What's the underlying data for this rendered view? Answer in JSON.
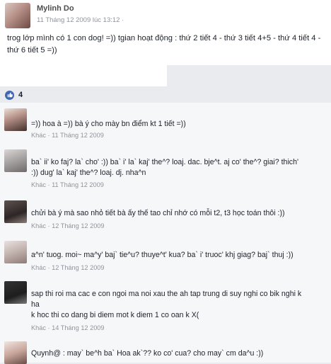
{
  "post": {
    "author": "Mylinh Do",
    "time": "11 Tháng 12 2009 lúc 13:12 ·",
    "text": "trog lớp mình có 1 con dog! =)) tgian hoạt động : thứ 2 tiết 4 - thứ 3 tiết 4+5 - thứ 4 tiết 4 - thứ 6 tiết 5 =))",
    "avatar_icon": "profile-photo-icon"
  },
  "likes": {
    "count": "4",
    "icon": "like-thumb-icon",
    "color": "#4267b2"
  },
  "comments": [
    {
      "lines": [
        "=)) hoa à =)) bà ý cho mày bn điểm kt 1 tiết =))"
      ],
      "meta": "Khác · 11 Tháng 12 2009"
    },
    {
      "lines": [
        "ba` ii' ko faj? la` cho' :)) ba` i' la` kaj' the^? loaj. dac. bje^t. aj co' the^? giai? thich'",
        ":)) dug' la` kaj' the^? loaj. dj. nha^n"
      ],
      "meta": "Khác · 11 Tháng 12 2009"
    },
    {
      "lines": [
        "chửi bà ý mà sao nhỏ tiết bà ấy thế tao chỉ nhớ có mỗi t2, t3 học toán thôi :))"
      ],
      "meta": "Khác · 12 Tháng 12 2009"
    },
    {
      "lines": [
        "a^n' tuog. moi~ ma^y' baj` tie^u? thuye^t' kua? ba` i' truoc' khj giag? baj` thuj :))"
      ],
      "meta": "Khác · 12 Tháng 12 2009"
    },
    {
      "lines": [
        "sap thi roi ma cac e con ngoi ma noi xau the ah tap trung di suy nghi co bik nghi k",
        "ha",
        "k hoc thi co dang bi diem mot k diem 1 co oan k X("
      ],
      "meta": "Khác · 14 Tháng 12 2009"
    },
    {
      "lines": [
        "Quynh@ : may` be^h ba` Hoa ak`?? ko co' cua? cho may` cm da^u :))"
      ],
      "meta": ""
    }
  ]
}
